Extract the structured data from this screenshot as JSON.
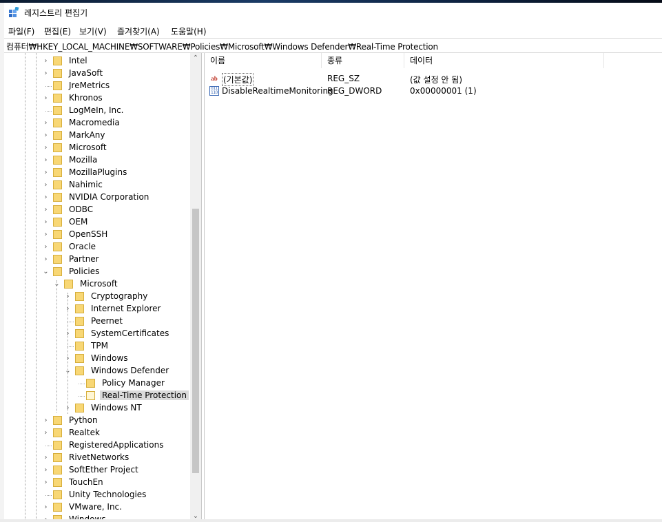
{
  "window": {
    "title": "레지스트리 편집기"
  },
  "menu": [
    "파일(F)",
    "편집(E)",
    "보기(V)",
    "즐겨찾기(A)",
    "도움말(H)"
  ],
  "address": "컴퓨터₩HKEY_LOCAL_MACHINE₩SOFTWARE₩Policies₩Microsoft₩Windows Defender₩Real-Time Protection",
  "tree": [
    {
      "label": "Intel",
      "depth": 0,
      "expander": "collapsed"
    },
    {
      "label": "JavaSoft",
      "depth": 0,
      "expander": "collapsed"
    },
    {
      "label": "JreMetrics",
      "depth": 0,
      "expander": "none"
    },
    {
      "label": "Khronos",
      "depth": 0,
      "expander": "collapsed"
    },
    {
      "label": "LogMeIn, Inc.",
      "depth": 0,
      "expander": "none"
    },
    {
      "label": "Macromedia",
      "depth": 0,
      "expander": "collapsed"
    },
    {
      "label": "MarkAny",
      "depth": 0,
      "expander": "collapsed"
    },
    {
      "label": "Microsoft",
      "depth": 0,
      "expander": "collapsed"
    },
    {
      "label": "Mozilla",
      "depth": 0,
      "expander": "collapsed"
    },
    {
      "label": "MozillaPlugins",
      "depth": 0,
      "expander": "collapsed"
    },
    {
      "label": "Nahimic",
      "depth": 0,
      "expander": "collapsed"
    },
    {
      "label": "NVIDIA Corporation",
      "depth": 0,
      "expander": "collapsed"
    },
    {
      "label": "ODBC",
      "depth": 0,
      "expander": "collapsed"
    },
    {
      "label": "OEM",
      "depth": 0,
      "expander": "collapsed"
    },
    {
      "label": "OpenSSH",
      "depth": 0,
      "expander": "collapsed"
    },
    {
      "label": "Oracle",
      "depth": 0,
      "expander": "collapsed"
    },
    {
      "label": "Partner",
      "depth": 0,
      "expander": "collapsed"
    },
    {
      "label": "Policies",
      "depth": 0,
      "expander": "expanded"
    },
    {
      "label": "Microsoft",
      "depth": 1,
      "expander": "expanded"
    },
    {
      "label": "Cryptography",
      "depth": 2,
      "expander": "collapsed"
    },
    {
      "label": "Internet Explorer",
      "depth": 2,
      "expander": "collapsed"
    },
    {
      "label": "Peernet",
      "depth": 2,
      "expander": "none"
    },
    {
      "label": "SystemCertificates",
      "depth": 2,
      "expander": "collapsed"
    },
    {
      "label": "TPM",
      "depth": 2,
      "expander": "none"
    },
    {
      "label": "Windows",
      "depth": 2,
      "expander": "collapsed"
    },
    {
      "label": "Windows Defender",
      "depth": 2,
      "expander": "expanded"
    },
    {
      "label": "Policy Manager",
      "depth": 3,
      "expander": "none"
    },
    {
      "label": "Real-Time Protection",
      "depth": 3,
      "expander": "none",
      "selected": true
    },
    {
      "label": "Windows NT",
      "depth": 2,
      "expander": "collapsed"
    },
    {
      "label": "Python",
      "depth": 0,
      "expander": "collapsed"
    },
    {
      "label": "Realtek",
      "depth": 0,
      "expander": "collapsed"
    },
    {
      "label": "RegisteredApplications",
      "depth": 0,
      "expander": "none"
    },
    {
      "label": "RivetNetworks",
      "depth": 0,
      "expander": "collapsed"
    },
    {
      "label": "SoftEther Project",
      "depth": 0,
      "expander": "collapsed"
    },
    {
      "label": "TouchEn",
      "depth": 0,
      "expander": "collapsed"
    },
    {
      "label": "Unity Technologies",
      "depth": 0,
      "expander": "none"
    },
    {
      "label": "VMware, Inc.",
      "depth": 0,
      "expander": "collapsed"
    },
    {
      "label": "Windows",
      "depth": 0,
      "expander": "collapsed"
    }
  ],
  "columns": {
    "name": "이름",
    "type": "종류",
    "data": "데이터"
  },
  "values": [
    {
      "name": "(기본값)",
      "type": "REG_SZ",
      "data": "(값 설정 안 됨)",
      "icon": "string-value-icon"
    },
    {
      "name": "DisableRealtimeMonitoring",
      "type": "REG_DWORD",
      "data": "0x00000001 (1)",
      "icon": "binary-value-icon"
    }
  ],
  "icon_glyphs": {
    "string": "ab",
    "binary": "011 110",
    "collapsed": "›",
    "expanded": "⌄",
    "scroll_up": "⌃",
    "scroll_down": "⌄"
  }
}
